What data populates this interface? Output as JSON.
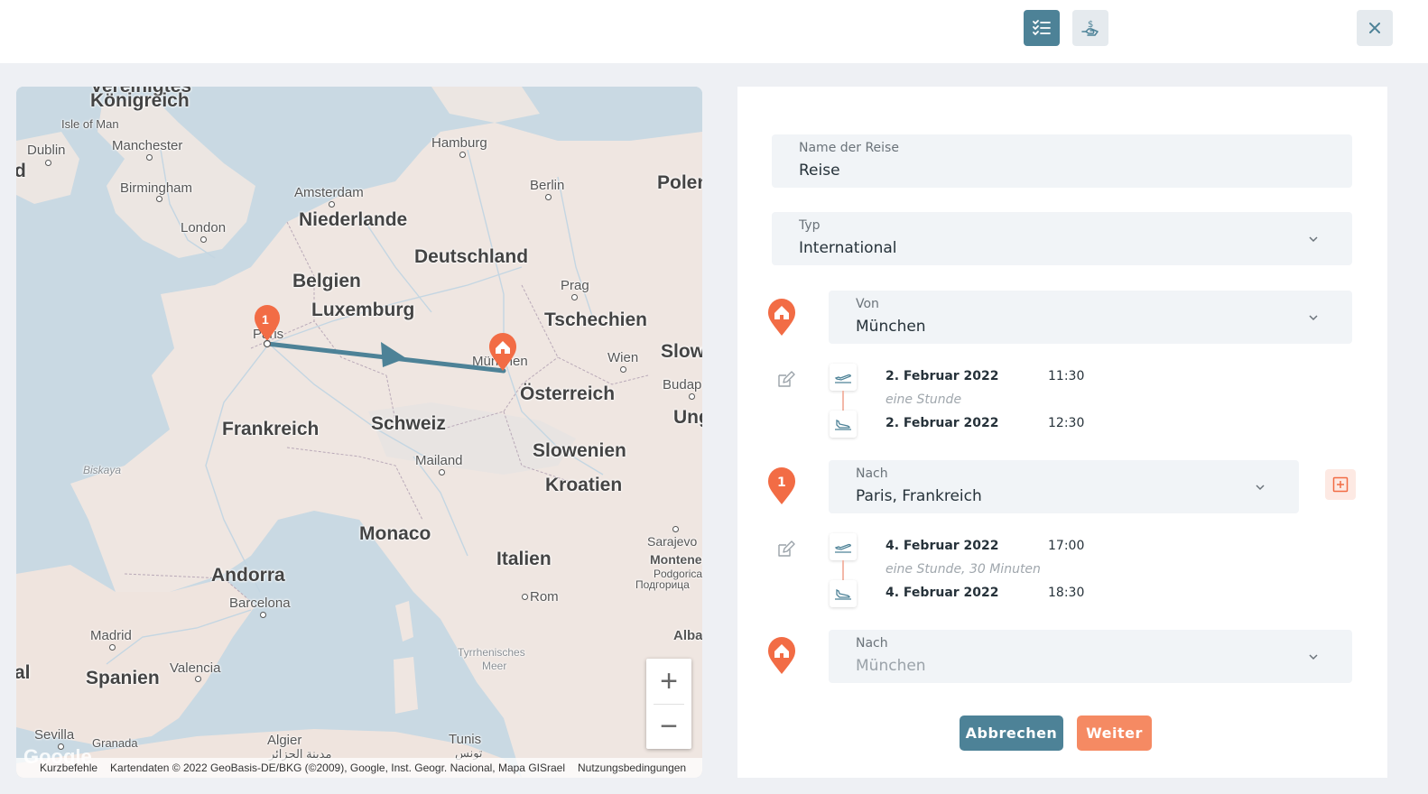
{
  "topbar": {
    "list_button_icon": "checklist-icon",
    "money_button_icon": "hand-coin-icon",
    "close_button_icon": "close-icon"
  },
  "map": {
    "labels": {
      "koenigreich": "Königreich",
      "vereinigtes": "Vereinigtes",
      "isle_of_man": "Isle of Man",
      "dublin": "Dublin",
      "manchester": "Manchester",
      "birmingham": "Birmingham",
      "london": "London",
      "amsterdam": "Amsterdam",
      "niederlande": "Niederlande",
      "hamburg": "Hamburg",
      "berlin": "Berlin",
      "polen": "Polen",
      "deutschland": "Deutschland",
      "belgien": "Belgien",
      "luxemburg": "Luxemburg",
      "prag": "Prag",
      "tschechien": "Tschechien",
      "paris": "Paris",
      "muenchen": "München",
      "wien": "Wien",
      "slowakei": "Slow",
      "budapest": "Budap",
      "oesterreich": "Österreich",
      "ungarn": "Ung",
      "frankreich": "Frankreich",
      "schweiz": "Schweiz",
      "slowenien": "Slowenien",
      "biskaya": "Biskaya",
      "mailand": "Mailand",
      "kroatien": "Kroatien",
      "monaco": "Monaco",
      "sarajevo": "Sarajevo",
      "montenegro": "Montene",
      "podgorica": "Podgorica",
      "podgorica_cyr": "Подгорица",
      "italien": "Italien",
      "andorra": "Andorra",
      "barcelona": "Barcelona",
      "rom": "Rom",
      "madrid": "Madrid",
      "albanien": "Alba",
      "spanien": "Spanien",
      "valencia": "Valencia",
      "tyrrhenisches": "Tyrrhenisches",
      "meer": "Meer",
      "sevilla": "Sevilla",
      "granada": "Granada",
      "algier": "Algier",
      "algier_ar": "مدينة الجزائر",
      "tunis": "Tunis",
      "tunis_ar": "تونس",
      "left_edge_d": "d",
      "left_edge_al": "al"
    },
    "marker_number": "1",
    "zoom_in": "+",
    "zoom_out": "−",
    "google_watermark": "Google",
    "attribution": {
      "shortcuts": "Kurzbefehle",
      "data": "Kartendaten © 2022 GeoBasis-DE/BKG (©2009), Google, Inst. Geogr. Nacional, Mapa GISrael",
      "terms": "Nutzungsbedingungen"
    },
    "route_color": "#4d8297",
    "marker_color": "#f26c45"
  },
  "form": {
    "name": {
      "label": "Name der Reise",
      "value": "Reise"
    },
    "type": {
      "label": "Typ",
      "value": "International"
    },
    "from": {
      "label": "Von",
      "value": "München"
    },
    "segment1": {
      "depart_date": "2. Februar 2022",
      "depart_time": "11:30",
      "duration": "eine Stunde",
      "arrive_date": "2. Februar 2022",
      "arrive_time": "12:30"
    },
    "to1": {
      "label": "Nach",
      "value": "Paris, Frankreich",
      "marker_number": "1"
    },
    "segment2": {
      "depart_date": "4. Februar 2022",
      "depart_time": "17:00",
      "duration": "eine Stunde, 30 Minuten",
      "arrive_date": "4. Februar 2022",
      "arrive_time": "18:30"
    },
    "to2": {
      "label": "Nach",
      "placeholder": "München"
    },
    "cancel_label": "Abbrechen",
    "next_label": "Weiter"
  }
}
